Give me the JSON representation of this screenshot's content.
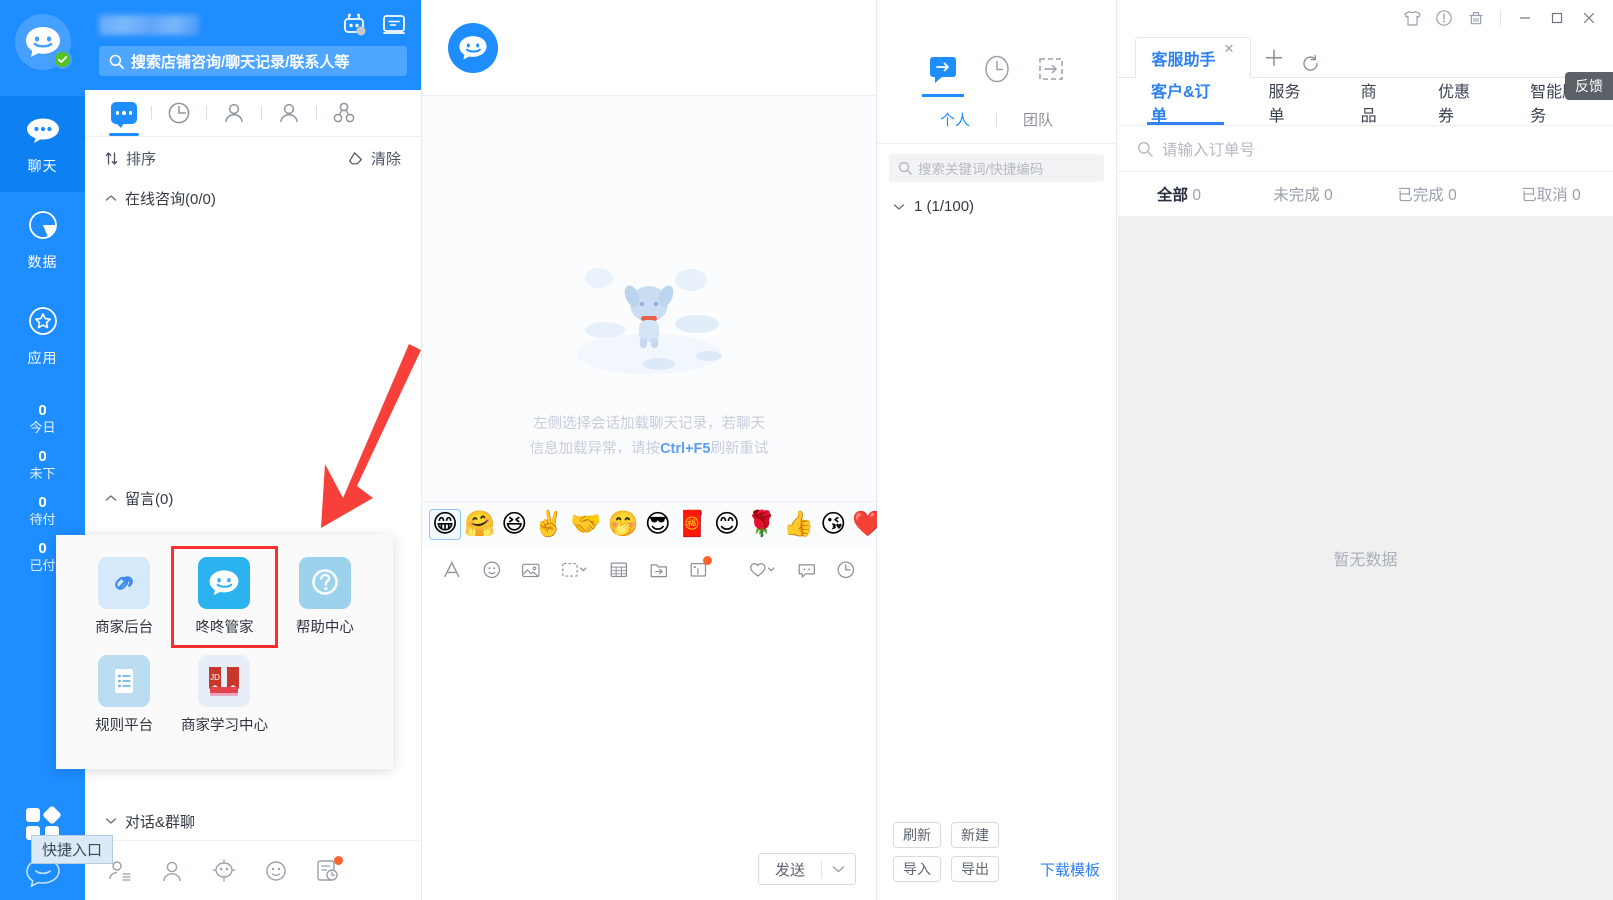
{
  "rail": {
    "logo_icon": "dongdong-logo-icon",
    "online_badge": "online-check-icon",
    "items": [
      {
        "label": "聊天",
        "icon": "chat-dots-icon",
        "active": true
      },
      {
        "label": "数据",
        "icon": "pie-chart-icon",
        "active": false
      },
      {
        "label": "应用",
        "icon": "apps-star-icon",
        "active": false
      }
    ],
    "stats": [
      {
        "num": "0",
        "label": "今日"
      },
      {
        "num": "0",
        "label": "未下"
      },
      {
        "num": "0",
        "label": "待付"
      },
      {
        "num": "0",
        "label": "已付"
      }
    ],
    "quick_entry_icon": "grid-apps-icon",
    "quick_entry_tooltip": "快捷入口",
    "bottom_logo_icon": "dongdong-outline-icon"
  },
  "conversation": {
    "header": {
      "shop_name_masked": "",
      "robot_icon": "robot-icon",
      "screen_icon": "monitor-chat-icon",
      "search_placeholder": "搜索店铺咨询/聊天记录/联系人等",
      "search_icon": "search-icon"
    },
    "tabs": [
      {
        "icon": "chat-bubble-icon",
        "name": "tab-chat",
        "active": true
      },
      {
        "icon": "clock-history-icon",
        "name": "tab-history",
        "active": false
      },
      {
        "icon": "user-icon",
        "name": "tab-contacts",
        "active": false
      },
      {
        "icon": "user-outline-icon",
        "name": "tab-customers",
        "active": false
      },
      {
        "icon": "group-users-icon",
        "name": "tab-groups",
        "active": false
      }
    ],
    "sort_label": "排序",
    "sort_icon": "sort-icon",
    "clear_label": "清除",
    "clear_icon": "eraser-icon",
    "groups": [
      {
        "label": "在线咨询(0/0)",
        "expanded": true
      },
      {
        "label": "留言(0)",
        "expanded": true
      },
      {
        "label": "对话&群聊",
        "expanded": false
      }
    ],
    "footer_icons": [
      "contact-list-icon",
      "person-icon",
      "robot-face-icon",
      "smiley-outline-icon",
      "schedule-alert-icon"
    ]
  },
  "quick_popup": {
    "items": [
      {
        "label": "商家后台",
        "icon": "link-chain-icon",
        "highlight": false
      },
      {
        "label": "咚咚管家",
        "icon": "dongdong-steward-icon",
        "highlight": true
      },
      {
        "label": "帮助中心",
        "icon": "question-help-icon",
        "highlight": false
      },
      {
        "label": "规则平台",
        "icon": "rules-list-icon",
        "highlight": false
      },
      {
        "label": "商家学习中心",
        "icon": "jd-learning-icon",
        "highlight": false
      }
    ],
    "highlight_color": "#FF2E2E"
  },
  "chat": {
    "logo_icon": "dongdong-avatar-icon",
    "empty_illustration": "dog-empty-illustration",
    "empty_text_part1": "左侧选择会话加载聊天记录，若聊天信息加载异常，请按",
    "empty_text_highlight": "Ctrl+F5",
    "empty_text_part2": "刷新重试",
    "emojis": [
      "😁",
      "🤗",
      "😆",
      "✌️",
      "🤝",
      "🤭",
      "😎",
      "🧧",
      "😊",
      "🌹",
      "👍",
      "😘",
      "❤️"
    ],
    "selected_emoji_index": 0,
    "tools": [
      "font-style-icon",
      "emoji-icon",
      "image-icon",
      "screenshot-icon",
      "table-icon",
      "file-send-icon",
      "card-send-icon",
      "favorite-icon",
      "quick-reply-icon",
      "history-clock-icon"
    ],
    "send_label": "发送",
    "send_caret_icon": "chevron-down-icon"
  },
  "quick_reply": {
    "top_tabs": [
      {
        "icon": "reply-arrow-icon",
        "name": "tab-quick-reply",
        "active": true
      },
      {
        "icon": "clock-icon",
        "name": "tab-recent",
        "active": false
      },
      {
        "icon": "export-arrow-icon",
        "name": "tab-transfer",
        "active": false
      }
    ],
    "tabs": [
      {
        "label": "个人",
        "active": true
      },
      {
        "label": "团队",
        "active": false
      }
    ],
    "search_placeholder": "搜索关键词/快捷编码",
    "search_icon": "search-icon",
    "group_label": "1 (1/100)",
    "buttons": [
      "刷新",
      "新建",
      "导入",
      "导出"
    ],
    "download_link": "下载模板"
  },
  "assistant": {
    "window_controls": [
      {
        "icon": "shirt-icon",
        "name": "theme-button"
      },
      {
        "icon": "exclamation-circle-icon",
        "name": "notice-button"
      },
      {
        "icon": "trash-icon",
        "name": "clean-button"
      },
      {
        "icon": "minimize-icon",
        "name": "minimize-button"
      },
      {
        "icon": "maximize-icon",
        "name": "maximize-button"
      },
      {
        "icon": "close-icon",
        "name": "close-button"
      }
    ],
    "tab_title": "客服助手",
    "tab_close_icon": "close-small-icon",
    "add_icon": "plus-icon",
    "refresh_icon": "refresh-icon",
    "subtabs": [
      {
        "label": "客户&订单",
        "active": true
      },
      {
        "label": "服务单",
        "active": false
      },
      {
        "label": "商品",
        "active": false
      },
      {
        "label": "优惠券",
        "active": false
      },
      {
        "label": "智能服务",
        "active": false
      }
    ],
    "feedback_label": "反馈",
    "order_search_placeholder": "请输入订单号",
    "order_search_icon": "search-icon",
    "filters": [
      {
        "label": "全部",
        "count": "0",
        "active": true
      },
      {
        "label": "未完成",
        "count": "0",
        "active": false
      },
      {
        "label": "已完成",
        "count": "0",
        "active": false
      },
      {
        "label": "已取消",
        "count": "0",
        "active": false
      }
    ],
    "empty_text": "暂无数据"
  },
  "colors": {
    "brand_blue": "#1E8DFF",
    "rail_active": "#0D80F2",
    "link_blue": "#2F80F0",
    "highlight_red": "#FF2E2E",
    "online_green": "#52C41A",
    "empty_bg": "#F0F0F0"
  }
}
